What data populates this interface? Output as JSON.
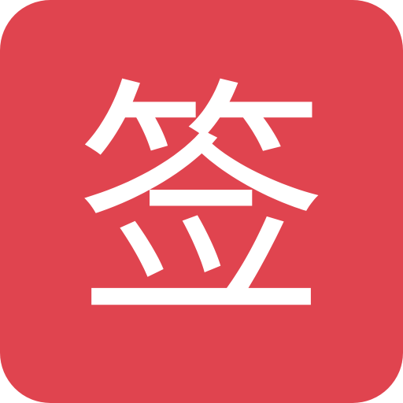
{
  "icon": {
    "glyph": "签",
    "background_color": "#e0444f",
    "glyph_color": "#ffffff"
  }
}
